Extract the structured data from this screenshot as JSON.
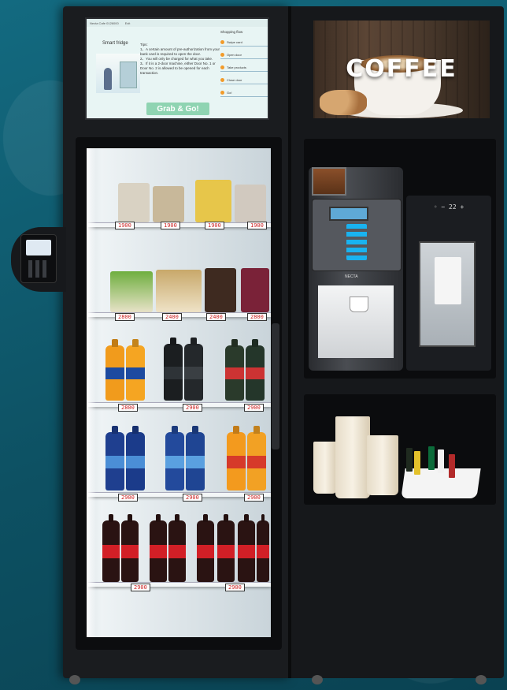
{
  "screen": {
    "topbar_a": "Necta Cafe 0126000",
    "topbar_b": "Exit",
    "title": "Smart fridge",
    "tips_heading": "Tips:",
    "tips": [
      "1、A certain amount of pre-authorization from your bank card is required to open the door.",
      "2、You will only be charged for what you take.",
      "3、If it is a 2-door machine, either Door No. 1 or Door No. 2 is allowed to be opened for each transaction."
    ],
    "flow_title": "Shopping flow",
    "flow_steps": [
      "Swipe card",
      "Open door",
      "Take products",
      "Close door",
      "Go!"
    ],
    "button_label": "Grab & Go!"
  },
  "banner": {
    "text": "COFFEE"
  },
  "milk_unit": {
    "display": "◦ − 22 +"
  },
  "machine": {
    "brand": "NECTA"
  },
  "price_tags": {
    "row1": [
      "1900",
      "1900",
      "1900",
      "1900"
    ],
    "row2": [
      "2800",
      "2400",
      "2400",
      "2800"
    ],
    "row3": [
      "2800",
      "2900",
      "2900"
    ],
    "row4": [
      "2900",
      "2900",
      "2900"
    ],
    "row5": [
      "2900",
      "2900"
    ]
  },
  "colors": {
    "background": "#0f5b6e",
    "cabinet": "#1a1c1f",
    "screen_button": "#8fd4b2",
    "price_text": "#cc2222"
  }
}
